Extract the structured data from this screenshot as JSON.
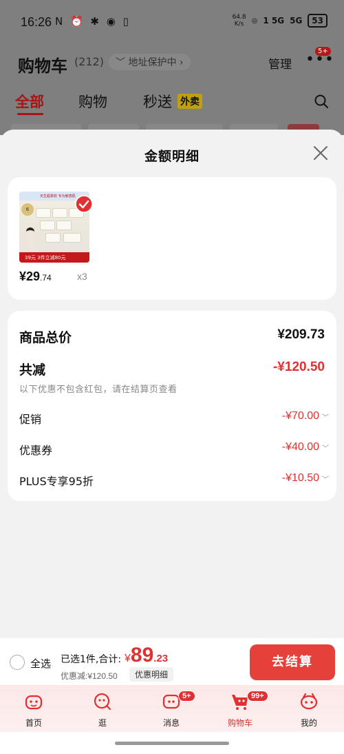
{
  "status_bar": {
    "time": "16:26",
    "left_icons": "N ⏰ ✱ ◉ ▯",
    "net_speed_value": "64.8",
    "net_speed_unit": "K/s",
    "signal_1": "1 5G",
    "signal_2": "5G",
    "battery": "53"
  },
  "header": {
    "title": "购物车",
    "count": "(212)",
    "address_protect": "地址保护中",
    "manage": "管理",
    "more_badge": "5+"
  },
  "tabs": [
    {
      "label": "全部",
      "active": true
    },
    {
      "label": "购物",
      "active": false
    },
    {
      "label": "秒送",
      "active": false
    }
  ],
  "waimai_tag": "外卖",
  "sheet": {
    "title": "金额明细"
  },
  "product": {
    "image_header_text": "天生超柔软 专为敏感肌",
    "image_footer_text": "39元 3件立减80元",
    "image_badge_text": "6",
    "price_int": "¥29",
    "price_dec": ".74",
    "qty": "x3"
  },
  "details": {
    "total_label": "商品总价",
    "total_value": "¥209.73",
    "discount_label": "共减",
    "discount_value": "-¥120.50",
    "note": "以下优惠不包含红包，请在结算页查看",
    "items": [
      {
        "label": "促销",
        "value": "-¥70.00"
      },
      {
        "label": "优惠券",
        "value": "-¥40.00"
      },
      {
        "label": "PLUS专享95折",
        "value": "-¥10.50"
      }
    ]
  },
  "bottom_bar": {
    "select_all": "全选",
    "selected_summary": "已选1件,合计:",
    "sum_currency": "¥",
    "sum_int": "89",
    "sum_dec": ".23",
    "discount_summary": "优惠减:¥120.50",
    "detail_button": "优惠明细",
    "checkout": "去结算"
  },
  "nav": [
    {
      "label": "首页",
      "icon": "home-icon",
      "badge": ""
    },
    {
      "label": "逛",
      "icon": "explore-icon",
      "badge": ""
    },
    {
      "label": "消息",
      "icon": "message-icon",
      "badge": "5+"
    },
    {
      "label": "购物车",
      "icon": "cart-icon",
      "badge": "99+",
      "active": true
    },
    {
      "label": "我的",
      "icon": "profile-icon",
      "badge": ""
    }
  ],
  "colors": {
    "accent_red": "#e23030",
    "checkout_red": "#e5403a",
    "dim_overlay": "#7f7f7f"
  }
}
